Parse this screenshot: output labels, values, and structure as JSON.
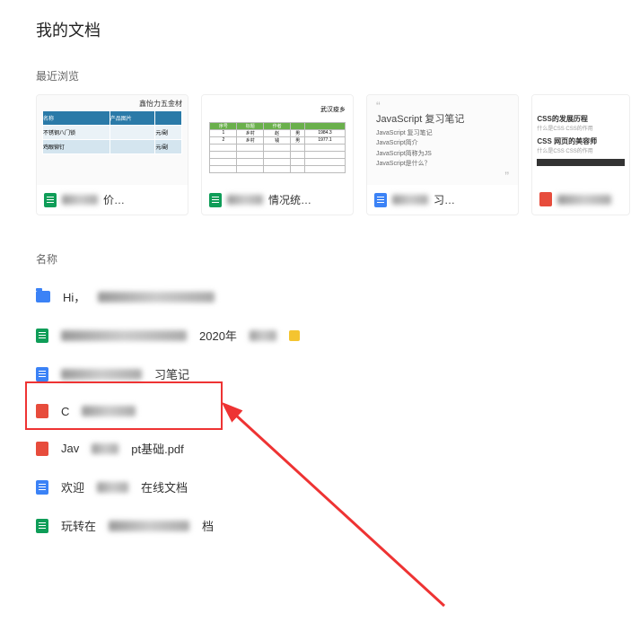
{
  "page_title": "我的文档",
  "recent_label": "最近浏览",
  "name_label": "名称",
  "card1": {
    "thumb_title": "鑫怡力五金材",
    "label_suffix": "价…",
    "h1": "名称",
    "h2": "产品图片",
    "r1": "不锈钢八门锁",
    "r2": "鸡眼铆钉",
    "p1": "元/副",
    "p2": "元/副"
  },
  "card2": {
    "left": "",
    "right": "武汉疫乡",
    "label_suffix": "情况统…",
    "c1": "序号",
    "c2": "标题",
    "c3": "作者",
    "c4": "",
    "r1a": "1",
    "r1b": "乡村",
    "r1c": "赵",
    "r1d": "男",
    "r1e": "1984.3",
    "r2a": "2",
    "r2b": "乡村",
    "r2c": "钱",
    "r2d": "男",
    "r2e": "1977.1"
  },
  "card3": {
    "title": "JavaScript 复习笔记",
    "l1": "JavaScript 复习笔记",
    "l2": "JavaScript简介",
    "l3": "JavaScript简称为JS",
    "l4": "JavaScript是什么？",
    "label_suffix": "习…"
  },
  "card4": {
    "h1": "CSS的发展历程",
    "h2": "CSS 网页的美容师",
    "p": "什么是CSS CSS的作用"
  },
  "rows": {
    "r1_prefix": "Hi，",
    "r2_suffix": "2020年",
    "r3_suffix": "习笔记",
    "r4_prefix": "C",
    "r5_prefix": "Jav",
    "r5_suffix": "pt基础.pdf",
    "r6_prefix": "欢迎",
    "r6_suffix": "在线文档",
    "r7_prefix": "玩转在",
    "r7_suffix": "档"
  }
}
